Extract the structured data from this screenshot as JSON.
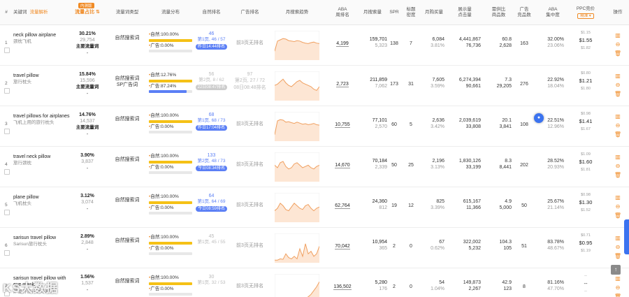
{
  "header": {
    "idx": "#",
    "keyword": "关键词",
    "keyword_link": "流量解析",
    "flow_badge": "内测版",
    "flow_share": "流量占比",
    "flow_type": "流量词类型",
    "flow_dist": "流量分布",
    "natural_rank": "自然排名",
    "ad_rank": "广告排名",
    "trend": "月搜索趋势",
    "aba": "ABA\n周排名",
    "search": "月搜索量",
    "spr": "SPR",
    "title": "标题\n密度",
    "buy": "月购买量",
    "impr": "展示量\n点击量",
    "comp": "需供比\n商品数",
    "adcnt": "广告\n竞品数",
    "conc": "ABA\n集中度",
    "ppc": "PPC竞价",
    "ppc_select": "精准",
    "ops": "操作"
  },
  "rows": [
    {
      "idx": "1",
      "kw_en": "neck pillow airplane",
      "kw_cn": "颈枕飞机",
      "flow_pct": "30.21%",
      "flow_cnt": "29,754",
      "flow_main": "主要流量词",
      "flow_dash": "-",
      "type": "自然搜索词",
      "nat_label": "自然:",
      "nat_pct": "100.00%",
      "ad_label": "广告:",
      "ad_pct": "0.00%",
      "sp_frac": 0,
      "nat_rank": "46",
      "nat_pos": "第1页, 46 / 57",
      "nat_tag": "昨日14:44排名",
      "nat_dim": false,
      "ad_rank": "前3页无排名",
      "aba": "4,199",
      "search1": "159,701",
      "search2": "5,323",
      "spr": "138",
      "title": "7",
      "buy1": "6,084",
      "buy2": "3.81%",
      "imp1": "4,441,867",
      "imp2": "76,736",
      "cmp1": "60.8",
      "cmp2": "2,628",
      "adc": "163",
      "conc1": "32.00%",
      "conc2": "23.06%",
      "ppc_lo": "$1.15",
      "ppc_mid": "$1.55",
      "ppc_hi": "$1.82",
      "trend": [
        0.3,
        0.7,
        0.75,
        0.8,
        0.78,
        0.72,
        0.7,
        0.68,
        0.72,
        0.7,
        0.65,
        0.62,
        0.6,
        0.64,
        0.66,
        0.62,
        0.6
      ]
    },
    {
      "idx": "2",
      "kw_en": "travel pillow",
      "kw_cn": "旅行枕头",
      "flow_pct": "15.84%",
      "flow_cnt": "15,596",
      "flow_main": "主要流量词",
      "flow_dash": "-",
      "type": "自然搜索词\nSP广告词",
      "nat_label": "自然:",
      "nat_pct": "12.76%",
      "ad_label": "广告:",
      "ad_pct": "87.24%",
      "sp_frac": 0.8724,
      "nat_rank": "56",
      "nat_pos": "第2页, 8 / 62",
      "nat_tag": "22日08:47排名",
      "nat_dim": true,
      "ad_rank": "97\n第2页, 27 / 72\n08日08:48排名",
      "ad_multi": true,
      "aba": "2,723",
      "search1": "211,859",
      "search2": "7,062",
      "spr": "173",
      "title": "31",
      "buy1": "7,605",
      "buy2": "3.59%",
      "imp1": "6,274,394",
      "imp2": "90,661",
      "cmp1": "7.3",
      "cmp2": "29,205",
      "adc": "276",
      "conc1": "22.92%",
      "conc2": "18.04%",
      "ppc_lo": "$0.80",
      "ppc_mid": "$1.21",
      "ppc_hi": "$1.80",
      "trend": [
        0.55,
        0.6,
        0.7,
        0.8,
        0.65,
        0.55,
        0.5,
        0.6,
        0.7,
        0.75,
        0.65,
        0.6,
        0.55,
        0.5,
        0.4,
        0.35,
        0.5
      ]
    },
    {
      "idx": "3",
      "kw_en": "travel pillows for airplanes",
      "kw_cn": "飞机上用的旅行枕头",
      "flow_pct": "14.76%",
      "flow_cnt": "14,537",
      "flow_main": "主要流量词",
      "flow_dash": "-",
      "type": "自然搜索词",
      "nat_label": "自然:",
      "nat_pct": "100.00%",
      "ad_label": "广告:",
      "ad_pct": "0.00%",
      "sp_frac": 0,
      "nat_rank": "68",
      "nat_pos": "第1页, 68 / 73",
      "nat_tag": "昨日17:04排名",
      "nat_dim": false,
      "ad_rank": "前3页无排名",
      "aba": "10,755",
      "search1": "77,101",
      "search2": "2,570",
      "spr": "60",
      "title": "5",
      "buy1": "2,636",
      "buy2": "3.42%",
      "imp1": "2,039,619",
      "imp2": "33,808",
      "cmp1": "20.1",
      "cmp2": "3,841",
      "adc": "108",
      "conc1": "22.51%",
      "conc2": "12.96%",
      "ppc_lo": "$0.98",
      "ppc_mid": "$1.41",
      "ppc_hi": "$1.67",
      "trend": [
        0.2,
        0.75,
        0.8,
        0.78,
        0.7,
        0.72,
        0.68,
        0.65,
        0.7,
        0.66,
        0.62,
        0.64,
        0.6,
        0.62,
        0.65,
        0.6,
        0.58
      ]
    },
    {
      "idx": "4",
      "kw_en": "travel neck pillow",
      "kw_cn": "旅行颈枕",
      "flow_pct": "3.90%",
      "flow_cnt": "3,837",
      "flow_main": "",
      "flow_dash": "-",
      "type": "自然搜索词",
      "nat_label": "自然:",
      "nat_pct": "100.00%",
      "ad_label": "广告:",
      "ad_pct": "0.00%",
      "sp_frac": 0,
      "nat_rank": "133",
      "nat_pos": "第2页, 48 / 73",
      "nat_tag": "今日08:34排名",
      "nat_dim": false,
      "ad_rank": "前3页无排名",
      "aba": "14,670",
      "search1": "70,184",
      "search2": "2,339",
      "spr": "50",
      "title": "25",
      "buy1": "2,196",
      "buy2": "3.13%",
      "imp1": "1,830,126",
      "imp2": "33,199",
      "cmp1": "8.3",
      "cmp2": "8,441",
      "adc": "202",
      "conc1": "28.52%",
      "conc2": "20.93%",
      "ppc_lo": "$1.09",
      "ppc_mid": "$1.60",
      "ppc_hi": "$1.81",
      "trend": [
        0.6,
        0.5,
        0.7,
        0.75,
        0.55,
        0.45,
        0.5,
        0.65,
        0.7,
        0.6,
        0.5,
        0.55,
        0.6,
        0.5,
        0.45,
        0.55,
        0.6
      ]
    },
    {
      "idx": "5",
      "kw_en": "plane pillow",
      "kw_cn": "飞机枕头",
      "flow_pct": "3.12%",
      "flow_cnt": "3,074",
      "flow_main": "",
      "flow_dash": "-",
      "type": "自然搜索词",
      "nat_label": "自然:",
      "nat_pct": "100.00%",
      "ad_label": "广告:",
      "ad_pct": "0.00%",
      "sp_frac": 0,
      "nat_rank": "64",
      "nat_pos": "第1页, 64 / 69",
      "nat_tag": "今日08:59排名",
      "nat_dim": false,
      "ad_rank": "前3页无排名",
      "aba": "62,764",
      "search1": "24,360",
      "search2": "812",
      "spr": "19",
      "title": "12",
      "buy1": "825",
      "buy2": "3.39%",
      "imp1": "615,167",
      "imp2": "11,366",
      "cmp1": "4.9",
      "cmp2": "5,000",
      "adc": "50",
      "conc1": "25.67%",
      "conc2": "21.14%",
      "ppc_lo": "$0.98",
      "ppc_mid": "$1.30",
      "ppc_hi": "$1.52",
      "trend": [
        0.4,
        0.5,
        0.7,
        0.6,
        0.45,
        0.4,
        0.55,
        0.7,
        0.6,
        0.5,
        0.45,
        0.6,
        0.65,
        0.5,
        0.4,
        0.5,
        0.55
      ]
    },
    {
      "idx": "6",
      "kw_en": "sarisun travel pillow",
      "kw_cn": "Sarisun旅行枕头",
      "flow_pct": "2.89%",
      "flow_cnt": "2,848",
      "flow_main": "",
      "flow_dash": "-",
      "type": "自然搜索词",
      "nat_label": "自然:",
      "nat_pct": "100.00%",
      "ad_label": "广告:",
      "ad_pct": "0.00%",
      "sp_frac": 0,
      "nat_rank": "45",
      "nat_pos": "第1页, 45 / 55",
      "nat_tag": "",
      "nat_dim": true,
      "ad_rank": "前3页无排名",
      "aba": "70,042",
      "search1": "10,954",
      "search2": "365",
      "spr": "2",
      "title": "0",
      "buy1": "67",
      "buy2": "0.62%",
      "imp1": "322,002",
      "imp2": "5,232",
      "cmp1": "104.3",
      "cmp2": "105",
      "adc": "51",
      "conc1": "83.78%",
      "conc2": "48.67%",
      "ppc_lo": "$0.71",
      "ppc_mid": "$0.95",
      "ppc_hi": "$1.19",
      "trend": [
        0.05,
        0.05,
        0.1,
        0.08,
        0.3,
        0.15,
        0.1,
        0.2,
        0.1,
        0.5,
        0.2,
        0.7,
        0.3,
        0.4,
        0.2,
        0.3,
        0.6
      ]
    },
    {
      "idx": "7",
      "kw_en": "sarisun travel pillow with eye mask",
      "kw_cn": "萨里孙旅行枕带眼罩",
      "flow_pct": "1.56%",
      "flow_cnt": "1,537",
      "flow_main": "",
      "flow_dash": "-",
      "type": "自然搜索词",
      "nat_label": "自然:",
      "nat_pct": "100.00%",
      "ad_label": "广告:",
      "ad_pct": "0.00%",
      "sp_frac": 0,
      "nat_rank": "30",
      "nat_pos": "第1页, 32 / 53",
      "nat_tag": "",
      "nat_dim": true,
      "ad_rank": "前3页无排名",
      "aba": "136,502",
      "search1": "5,280",
      "search2": "176",
      "spr": "2",
      "title": "0",
      "buy1": "54",
      "buy2": "1.04%",
      "imp1": "149,873",
      "imp2": "2,267",
      "cmp1": "42.9",
      "cmp2": "123",
      "adc": "8",
      "conc1": "81.16%",
      "conc2": "47.70%",
      "ppc_lo": "--",
      "ppc_mid": "--",
      "ppc_hi": "--",
      "trend": [
        0.02,
        0.02,
        0.02,
        0.03,
        0.02,
        0.05,
        0.03,
        0.04,
        0.05,
        0.1,
        0.08,
        0.15,
        0.2,
        0.3,
        0.45,
        0.6,
        0.8
      ]
    }
  ],
  "watermark": "KS大数据",
  "colors": {
    "accent": "#f08a24",
    "blue": "#5b7ff5",
    "yellow": "#f5c116",
    "trend_line": "#f0a060",
    "trend_fill": "#fde6d4"
  }
}
